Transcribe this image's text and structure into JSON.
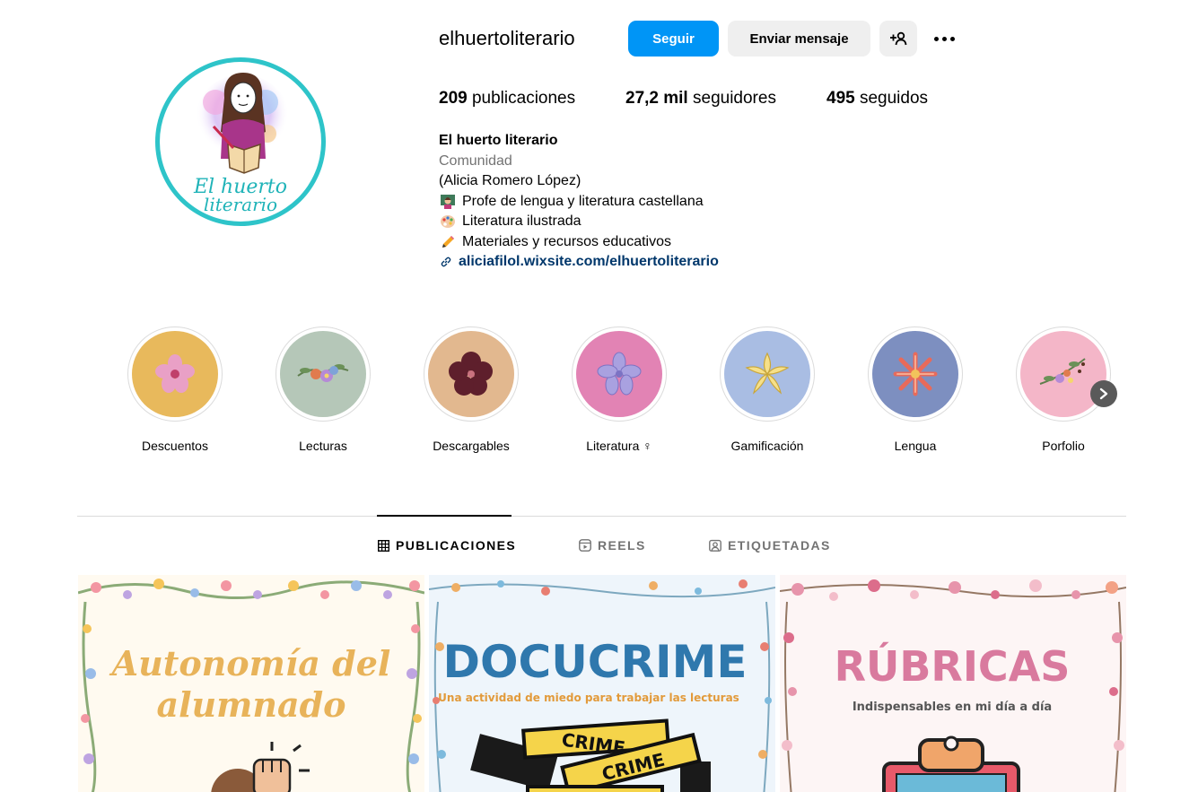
{
  "profile": {
    "username": "elhuertoliterario",
    "avatar_text_line1": "El huerto",
    "avatar_text_line2": "literario"
  },
  "actions": {
    "follow_label": "Seguir",
    "message_label": "Enviar mensaje",
    "add_user_icon": "person-add-icon",
    "more_icon": "more-options-icon"
  },
  "stats": {
    "posts_count": "209",
    "posts_label": "publicaciones",
    "followers_count": "27,2 mil",
    "followers_label": "seguidores",
    "following_count": "495",
    "following_label": "seguidos"
  },
  "bio": {
    "name": "El huerto literario",
    "category": "Comunidad",
    "line1": "(Alicia Romero López)",
    "line2": "Profe de lengua y literatura castellana",
    "line3": "Literatura ilustrada",
    "line4": "Materiales y recursos educativos",
    "link": "aliciafilol.wixsite.com/elhuertoliterario"
  },
  "highlights": [
    {
      "label": "Descuentos",
      "color": "#e8b95c"
    },
    {
      "label": "Lecturas",
      "color": "#b5c7b8"
    },
    {
      "label": "Descargables",
      "color": "#e2b88f"
    },
    {
      "label": "Literatura ♀",
      "color": "#e283b4"
    },
    {
      "label": "Gamificación",
      "color": "#a9bde3"
    },
    {
      "label": "Lengua",
      "color": "#7d8fc0"
    },
    {
      "label": "Porfolio",
      "color": "#f4b6c8"
    }
  ],
  "tabs": [
    {
      "label": "PUBLICACIONES",
      "icon": "grid-icon",
      "active": true
    },
    {
      "label": "REELS",
      "icon": "reels-icon",
      "active": false
    },
    {
      "label": "ETIQUETADAS",
      "icon": "tagged-icon",
      "active": false
    }
  ],
  "posts": [
    {
      "title_line1": "Autonomía del",
      "title_line2": "alumnado",
      "background": "#fffaf0",
      "title_color": "#e8b35a"
    },
    {
      "title": "DOCUCRIME",
      "subtitle": "Una actividad de miedo para trabajar las lecturas",
      "tape_text": "CRIME",
      "background": "#eef5fb",
      "title_color": "#2f78ad",
      "subtitle_color": "#e29a3a"
    },
    {
      "title": "RÚBRICAS",
      "subtitle": "Indispensables en mi día a día",
      "background": "#fdf5f5",
      "title_color": "#d97a9e"
    }
  ],
  "colors": {
    "accent": "#0095f6",
    "link": "#00376b",
    "secondary_text": "#737373",
    "avatar_ring": "#2ec4c9"
  }
}
